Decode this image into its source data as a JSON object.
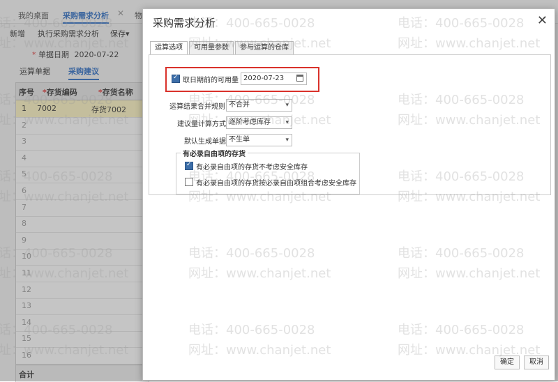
{
  "top_tabs": [
    {
      "label": "我的桌面"
    },
    {
      "label": "采购需求分析",
      "close": "✕"
    },
    {
      "label": "物"
    }
  ],
  "toolbar": {
    "new": "新增",
    "run": "执行采购需求分析",
    "save": "保存",
    "save_arrow": "▾"
  },
  "doc_date": {
    "label": "单据日期",
    "value": "2020-07-22"
  },
  "subtabs": {
    "calc": "运算单据",
    "suggest": "采购建议"
  },
  "grid": {
    "headers": {
      "seq": "序号",
      "code": "存货编码",
      "name": "存货名称"
    },
    "rows": [
      {
        "seq": "1",
        "code": "7002",
        "name": "存货7002"
      },
      {
        "seq": "2"
      },
      {
        "seq": "3"
      },
      {
        "seq": "4"
      },
      {
        "seq": "5"
      },
      {
        "seq": "6"
      },
      {
        "seq": "7"
      },
      {
        "seq": "8"
      },
      {
        "seq": "9"
      },
      {
        "seq": "10"
      },
      {
        "seq": "11"
      },
      {
        "seq": "12"
      },
      {
        "seq": "13"
      },
      {
        "seq": "14"
      },
      {
        "seq": "15"
      },
      {
        "seq": "16"
      }
    ],
    "total_label": "合计"
  },
  "dialog": {
    "title": "采购需求分析",
    "close": "✕",
    "tabs": [
      "运算选项",
      "可用量参数",
      "参与运算的仓库"
    ],
    "option_available": {
      "label": "取日期前的可用量",
      "value": "2020-07-23"
    },
    "merge_rule": {
      "label": "运算结果合并规则",
      "value": "不合并"
    },
    "suggest_method": {
      "label": "建议量计算方式",
      "value": "逐阶考虑库存"
    },
    "default_doc": {
      "label": "默认生成单据",
      "value": "不生单"
    },
    "group": {
      "legend": "有必录自由项的存货",
      "opt1": "有必录自由项的存货不考虑安全库存",
      "opt2": "有必录自由项的存货按必录自由项组合考虑安全库存"
    },
    "ok": "确定",
    "cancel": "取消"
  },
  "watermark": {
    "phone": "电话：400-665-0028",
    "site": "网址：www.chanjet.net"
  },
  "colors": {
    "accent": "#2b6cc4",
    "highlight_box": "#d9322b",
    "selected_row": "#fdf5c2"
  }
}
